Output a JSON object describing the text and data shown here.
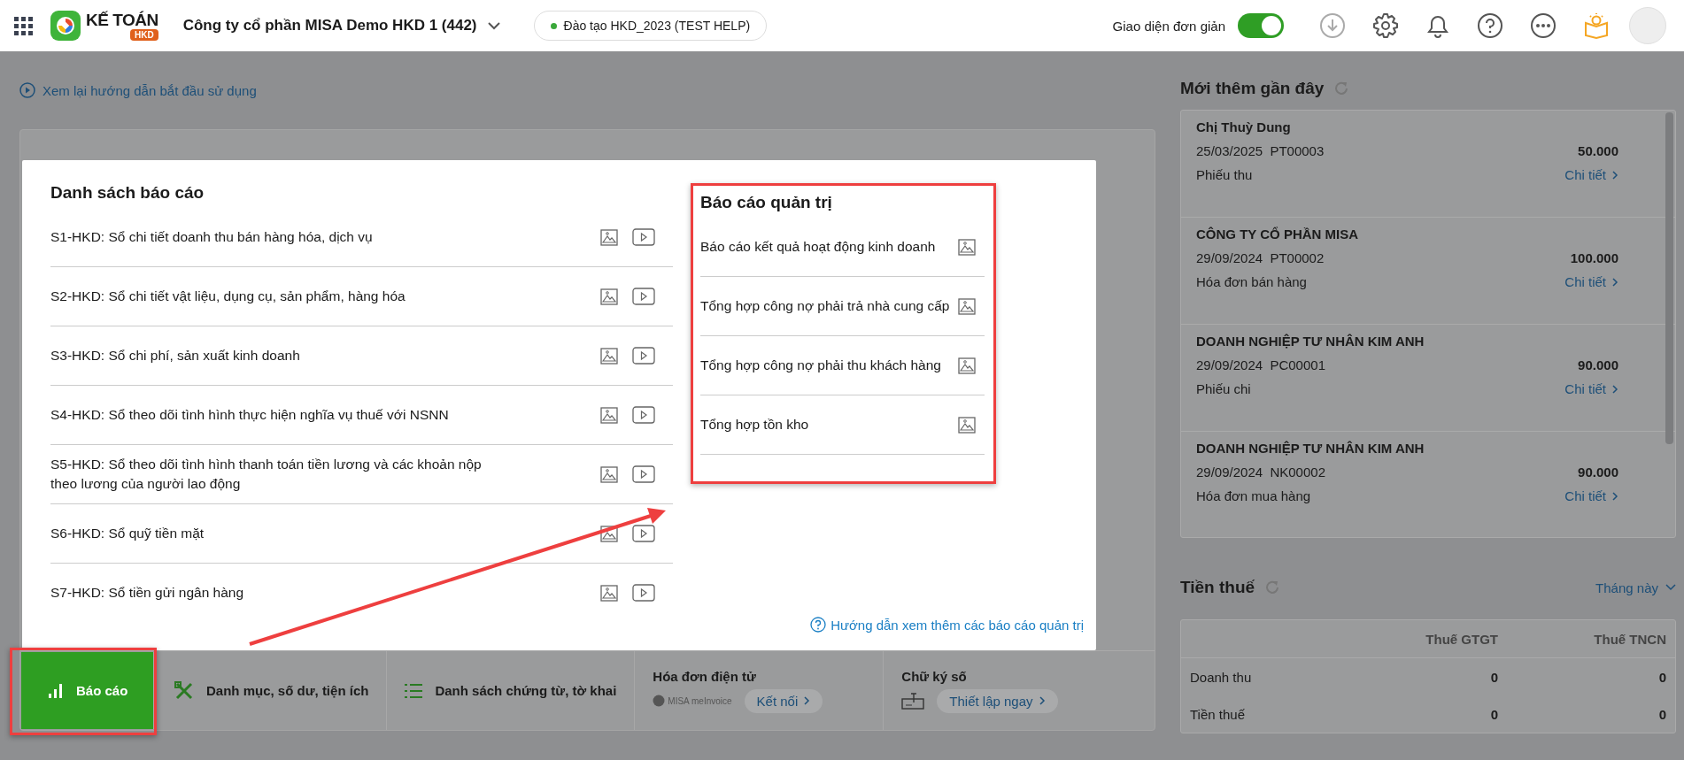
{
  "header": {
    "logo": {
      "title": "KẾ TOÁN",
      "badge": "HKD"
    },
    "company": "Công ty cổ phần MISA Demo HKD 1 (442)",
    "training_badge": "Đào tạo HKD_2023 (TEST HELP)",
    "simple_mode": {
      "label": "Giao diện đơn giản",
      "on": true
    }
  },
  "guide_link": "Xem lại hướng dẫn bắt đầu sử dụng",
  "reports_popup": {
    "list_title": "Danh sách báo cáo",
    "reports": [
      {
        "label": "S1-HKD: Sổ chi tiết doanh thu bán hàng hóa, dịch vụ"
      },
      {
        "label": "S2-HKD: Sổ chi tiết vật liệu, dụng cụ, sản phẩm, hàng hóa"
      },
      {
        "label": "S3-HKD: Sổ chi phí, sản xuất kinh doanh"
      },
      {
        "label": "S4-HKD: Sổ theo dõi tình hình thực hiện nghĩa vụ thuế với NSNN"
      },
      {
        "label": "S5-HKD: Sổ theo dõi tình hình thanh toán tiền lương và các khoản nộp theo lương của người lao động"
      },
      {
        "label": "S6-HKD: Sổ quỹ tiền mặt"
      },
      {
        "label": "S7-HKD: Sổ tiền gửi ngân hàng"
      }
    ],
    "management_title": "Báo cáo quản trị",
    "management_reports": [
      {
        "label": "Báo cáo kết quả hoạt động kinh doanh"
      },
      {
        "label": "Tổng hợp công nợ phải trả nhà cung cấp"
      },
      {
        "label": "Tổng hợp công nợ phải thu khách hàng"
      },
      {
        "label": "Tổng hợp tồn kho"
      }
    ],
    "help_link": "Hướng dẫn xem thêm các báo cáo quản trị"
  },
  "bottom_bar": [
    {
      "kind": "chart",
      "label": "Báo cáo",
      "selected": true
    },
    {
      "kind": "tools",
      "label": "Danh mục, số dư, tiện ích",
      "selected": false
    },
    {
      "kind": "list",
      "label": "Danh sách chứng từ, tờ khai",
      "selected": false
    },
    {
      "kind": "invoice",
      "title": "Hóa đơn điện tử",
      "logo_text": "MISA meInvoice",
      "action": "Kết nối"
    },
    {
      "kind": "signature",
      "title": "Chữ ký số",
      "action": "Thiết lập ngay"
    }
  ],
  "recent": {
    "title": "Mới thêm gần đây",
    "entries": [
      {
        "name": "Chị Thuỳ Dung",
        "date": "25/03/2025",
        "code": "PT00003",
        "amount": "50.000",
        "type": "Phiếu thu",
        "link": "Chi tiết"
      },
      {
        "name": "CÔNG TY CỔ PHẦN MISA",
        "date": "29/09/2024",
        "code": "PT00002",
        "amount": "100.000",
        "type": "Hóa đơn bán hàng",
        "link": "Chi tiết"
      },
      {
        "name": "DOANH NGHIỆP TƯ NHÂN KIM ANH",
        "date": "29/09/2024",
        "code": "PC00001",
        "amount": "90.000",
        "type": "Phiếu chi",
        "link": "Chi tiết"
      },
      {
        "name": "DOANH NGHIỆP TƯ NHÂN KIM ANH",
        "date": "29/09/2024",
        "code": "NK00002",
        "amount": "90.000",
        "type": "Hóa đơn mua hàng",
        "link": "Chi tiết"
      }
    ]
  },
  "tax": {
    "title": "Tiền thuế",
    "period": "Tháng này",
    "columns": [
      "Thuế GTGT",
      "Thuế TNCN"
    ],
    "rows": [
      {
        "label": "Doanh thu",
        "values": [
          "0",
          "0"
        ]
      },
      {
        "label": "Tiền thuế",
        "values": [
          "0",
          "0"
        ]
      }
    ]
  }
}
